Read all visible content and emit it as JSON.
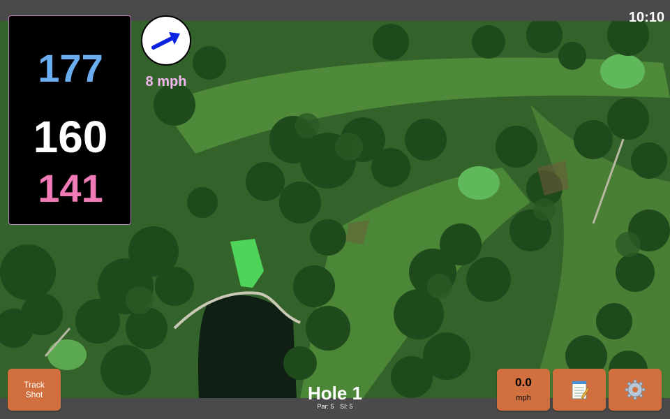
{
  "status": {
    "time": "10:10"
  },
  "yardage": {
    "back": "177",
    "middle": "160",
    "front": "141"
  },
  "wind": {
    "speed_label": "8 mph",
    "arrow_color": "#0b22e0"
  },
  "hole": {
    "title": "Hole 1",
    "par_label": "Par: 5",
    "si_label": "SI: 5"
  },
  "buttons": {
    "track_shot_label": "Track\nShot",
    "speed_value": "0.0",
    "speed_unit": "mph",
    "notes_icon": "notepad-icon",
    "settings_icon": "gear-icon"
  },
  "colors": {
    "button_bg": "#d1703e",
    "back_yardage": "#6aaef0",
    "front_yardage": "#f07ab5",
    "wind_text": "#f3b6f0"
  }
}
